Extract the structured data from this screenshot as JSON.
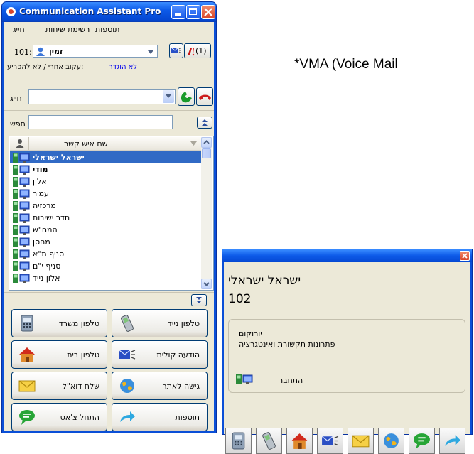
{
  "window": {
    "title": "Communication Assistant Pro"
  },
  "menu": {
    "items": [
      "תוספות",
      "רשימת שיחות",
      "חייג"
    ]
  },
  "extension": {
    "number": "101:",
    "status": "זמין",
    "alert_count": "(1)",
    "forward_link": "לא הוגדר",
    "forward_label": "עקוב אחרי / לא להפריע:"
  },
  "dial": {
    "label": "חייג",
    "value": ""
  },
  "search": {
    "label": "חפש",
    "value": ""
  },
  "list": {
    "column_header": "שם איש קשר",
    "rows": [
      {
        "name": "ישראל ישראלי",
        "selected": true,
        "bold": true
      },
      {
        "name": "מודי",
        "selected": false,
        "bold": true
      },
      {
        "name": "אלון",
        "selected": false,
        "bold": false
      },
      {
        "name": "עמיר",
        "selected": false,
        "bold": false
      },
      {
        "name": "מרכזיה",
        "selected": false,
        "bold": false
      },
      {
        "name": "חדר ישיבות",
        "selected": false,
        "bold": false
      },
      {
        "name": "המח\"ש",
        "selected": false,
        "bold": false
      },
      {
        "name": "מחסן",
        "selected": false,
        "bold": false
      },
      {
        "name": "סניף ת\"א",
        "selected": false,
        "bold": false
      },
      {
        "name": "סניף י\"ם",
        "selected": false,
        "bold": false
      },
      {
        "name": "אלון נייד",
        "selected": false,
        "bold": false
      }
    ]
  },
  "actions": {
    "office_phone": "טלפון משרד",
    "mobile_phone": "טלפון נייד",
    "home_phone": "טלפון בית",
    "voice_message": "הודעה קולית",
    "send_email": "שלח דוא\"ל",
    "website": "גישה לאתר",
    "start_chat": "התחל צ'אט",
    "extras": "תוספות"
  },
  "annotation": {
    "text": "*VMA (Voice Mail"
  },
  "popup": {
    "contact_name": "ישראל ישראלי",
    "extension": "102",
    "company": "יורוקום",
    "description": "פתרונות תקשורת ואינטגרציה",
    "status": "התחבר"
  },
  "colors": {
    "titlebar": "#0548d3",
    "selection": "#316ac5",
    "window_bg": "#ece9d8",
    "close_button": "#d9462a"
  }
}
